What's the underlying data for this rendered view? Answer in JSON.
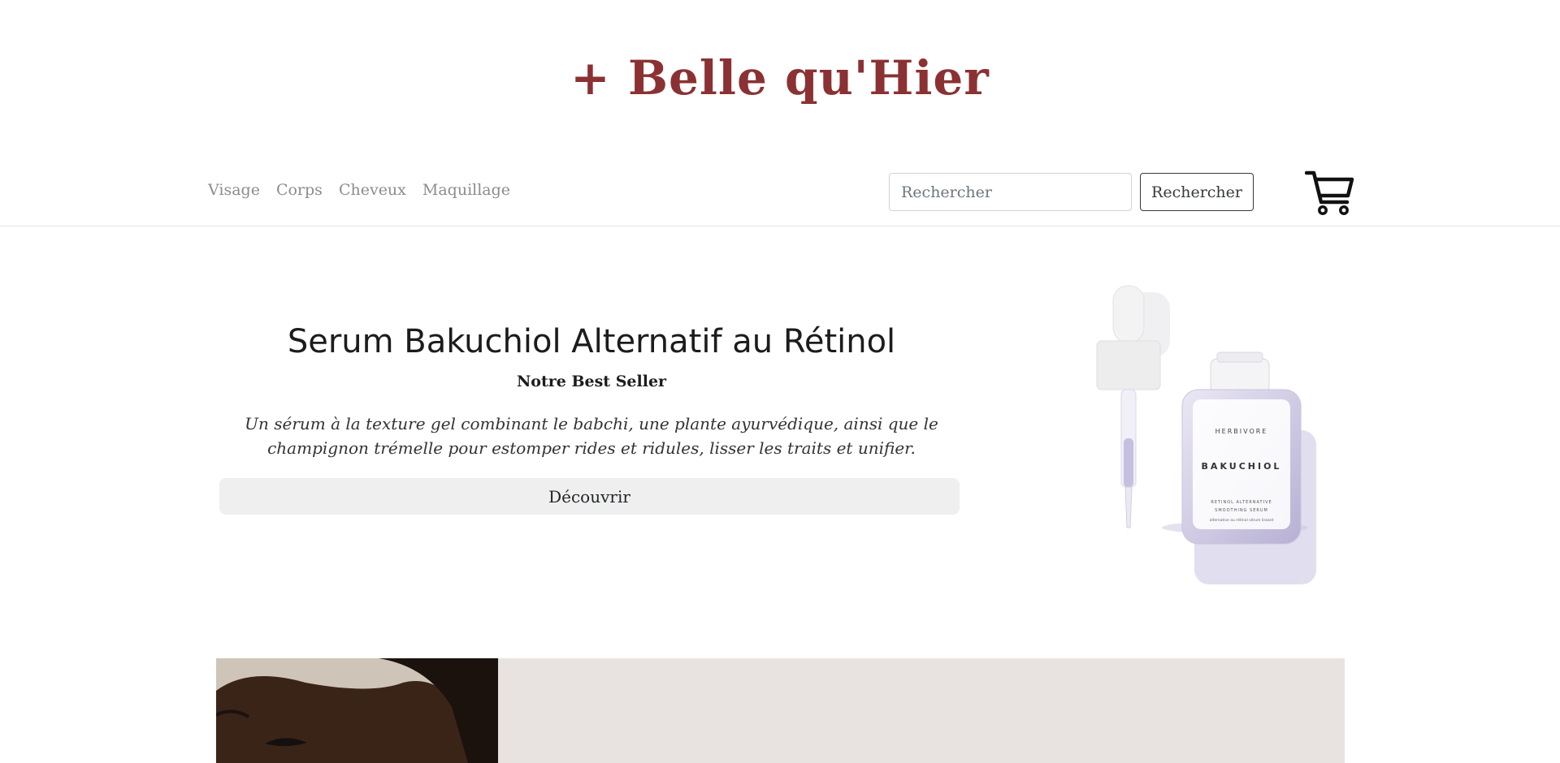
{
  "header": {
    "brand": "+ Belle qu'Hier"
  },
  "nav": {
    "items": [
      {
        "label": "Visage"
      },
      {
        "label": "Corps"
      },
      {
        "label": "Cheveux"
      },
      {
        "label": "Maquillage"
      }
    ],
    "search": {
      "placeholder": "Rechercher",
      "button_label": "Rechercher"
    },
    "cart_icon": "shopping-cart-icon"
  },
  "hero": {
    "title": "Serum Bakuchiol Alternatif au Rétinol",
    "subtitle": "Notre Best Seller",
    "description": "Un sérum à la texture gel combinant le babchi, une plante ayurvédique, ainsi que le champignon trémelle pour estomper rides et ridules, lisser les traits et unifier.",
    "cta_label": "Découvrir",
    "product": {
      "brand": "HERBIVORE",
      "name": "BAKUCHIOL",
      "line1": "RETINOL ALTERNATIVE",
      "line2": "SMOOTHING SERUM",
      "line3": "alternative au rétinol sérum lissant"
    }
  },
  "colors": {
    "brand": "#8b3133",
    "nav_text": "#8c8c8c",
    "cta_bg": "#efefef",
    "promo_bg": "#e8e3e1"
  }
}
